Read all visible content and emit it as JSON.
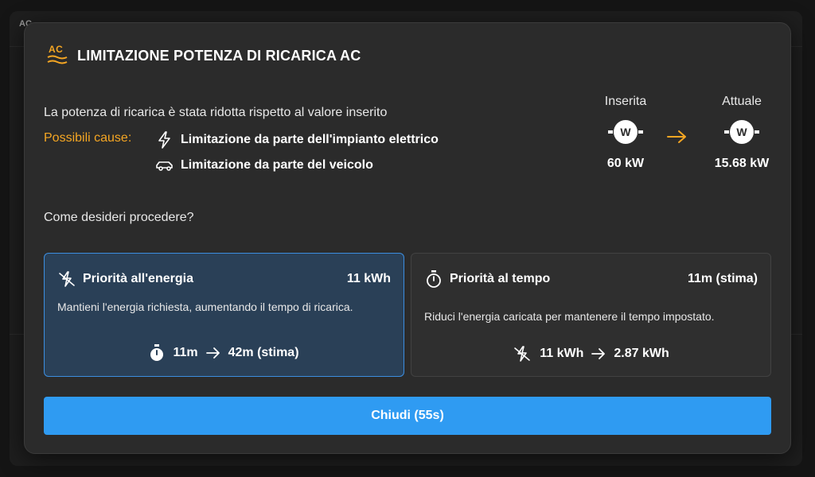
{
  "background": {
    "badge_text": "AC"
  },
  "dialog": {
    "badge_text": "AC",
    "title": "LIMITAZIONE POTENZA DI RICARICA AC",
    "description": "La potenza di ricarica è stata ridotta rispetto al valore inserito",
    "causes_label": "Possibili cause:",
    "causes": [
      {
        "icon": "lightning-icon",
        "label": "Limitazione da parte dell'impianto elettrico"
      },
      {
        "icon": "car-icon",
        "label": "Limitazione da parte del veicolo"
      }
    ],
    "power": {
      "set_label": "Inserita",
      "set_value": "60 kW",
      "actual_label": "Attuale",
      "actual_value": "15.68 kW",
      "plug_glyph": "W"
    },
    "question": "Come desideri procedere?",
    "options": [
      {
        "icon": "charging-priority-icon",
        "title": "Priorità all'energia",
        "value": "11 kWh",
        "description": "Mantieni l'energia richiesta, aumentando il tempo di ricarica.",
        "from": "11m",
        "to": "42m (stima)",
        "selected": true
      },
      {
        "icon": "stopwatch-icon",
        "title": "Priorità al tempo",
        "value": "11m (stima)",
        "description": "Riduci l'energia caricata per mantenere il tempo impostato.",
        "from": "11 kWh",
        "to": "2.87 kWh",
        "selected": false
      }
    ],
    "close_label": "Chiudi (55s)"
  },
  "colors": {
    "accent": "#f5a623",
    "primary": "#2f9bf2",
    "selected_bg": "#2a4057",
    "selected_border": "#3c8ee0",
    "dialog_bg": "#2b2b2b"
  }
}
